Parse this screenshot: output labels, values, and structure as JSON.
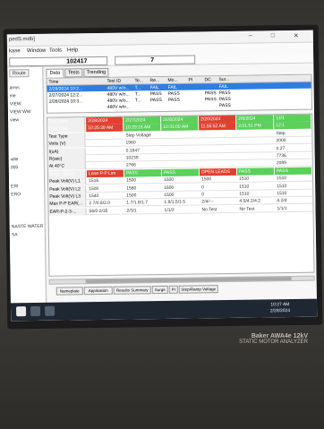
{
  "window": {
    "title": "pedS.mdb]",
    "controls": [
      "–",
      "□",
      "✕"
    ]
  },
  "menu": [
    "kase",
    "Window",
    "Tools",
    "Help"
  ],
  "id_fields": {
    "record_id": "102417",
    "count": "7"
  },
  "left_panel": {
    "tab": "Route",
    "items": [
      "arms",
      "me",
      "VIEW",
      "VIEW WW",
      "view",
      "",
      "ville",
      "005",
      "",
      "ERI",
      "ERO",
      "",
      "NASTE WATER",
      "SA"
    ]
  },
  "tabs": [
    "Data",
    "Tests",
    "Trending"
  ],
  "test_table": {
    "headers": [
      "Time",
      "Test ID",
      "Te...",
      "Re...",
      "Mo...",
      "PI",
      "DC",
      "Sur..."
    ],
    "rows": [
      {
        "time": "2/28/2024 10:2...",
        "test_id": "480V w/o...",
        "te": "T...",
        "re": "FAIL",
        "mo": "FAIL",
        "pi": "",
        "dc": "",
        "sur": "FAIL",
        "selected": true
      },
      {
        "time": "2/27/2024 12:2...",
        "test_id": "480V w/o...",
        "te": "T...",
        "re": "PASS",
        "mo": "PASS",
        "pi": "",
        "dc": "PASS",
        "sur": "PASS",
        "selected": false
      },
      {
        "time": "2/26/2024 10:3...",
        "test_id": "480V w/o...",
        "te": "T...",
        "re": "PASS",
        "mo": "PASS",
        "pi": "",
        "dc": "PASS",
        "sur": "PASS",
        "selected": false
      },
      {
        "time": "",
        "test_id": "480V w/o...",
        "te": "",
        "re": "",
        "mo": "",
        "pi": "",
        "dc": "",
        "sur": "PASS",
        "selected": false
      }
    ]
  },
  "data_grid": {
    "rows": [
      {
        "label": "Test Date",
        "label_style": "sel",
        "cells": [
          {
            "v": "2/28/2024",
            "s": "red"
          },
          {
            "v": "2/27/2024",
            "s": "green"
          },
          {
            "v": "2/26/2024",
            "s": "green"
          },
          {
            "v": "2/20/2024",
            "s": "red"
          },
          {
            "v": "2/8/2024",
            "s": "green"
          },
          {
            "v": "12/1",
            "s": "green"
          }
        ]
      },
      {
        "label": "Test Time",
        "label_style": "sel",
        "cells": [
          {
            "v": "10:25:39 AM",
            "s": "red"
          },
          {
            "v": "10:29:18 AM",
            "s": "green"
          },
          {
            "v": "10:31:00 AM",
            "s": "green"
          },
          {
            "v": "11:55:52 AM",
            "s": "red"
          },
          {
            "v": "2:01:51 PM",
            "s": "green"
          },
          {
            "v": "12:1",
            "s": "green"
          }
        ]
      },
      {
        "label": "Test Type",
        "cells": [
          {
            "v": "",
            "s": ""
          },
          {
            "v": "Step Voltage",
            "s": ""
          },
          {
            "v": "",
            "s": ""
          },
          {
            "v": "",
            "s": ""
          },
          {
            "v": "",
            "s": ""
          },
          {
            "v": "Step",
            "s": ""
          }
        ]
      },
      {
        "label": "Volts (V)",
        "cells": [
          {
            "v": "",
            "s": ""
          },
          {
            "v": "1960",
            "s": ""
          },
          {
            "v": "",
            "s": ""
          },
          {
            "v": "",
            "s": ""
          },
          {
            "v": "",
            "s": ""
          },
          {
            "v": "2000",
            "s": ""
          }
        ]
      },
      {
        "label": "I(uA)",
        "cells": [
          {
            "v": "",
            "s": ""
          },
          {
            "v": "0.1847",
            "s": ""
          },
          {
            "v": "",
            "s": ""
          },
          {
            "v": "",
            "s": ""
          },
          {
            "v": "",
            "s": ""
          },
          {
            "v": "0.27",
            "s": ""
          }
        ]
      },
      {
        "label": "R(sec)",
        "cells": [
          {
            "v": "",
            "s": ""
          },
          {
            "v": "10239",
            "s": ""
          },
          {
            "v": "",
            "s": ""
          },
          {
            "v": "",
            "s": ""
          },
          {
            "v": "",
            "s": ""
          },
          {
            "v": "7736",
            "s": ""
          }
        ]
      },
      {
        "label": "At 40°C",
        "cells": [
          {
            "v": "",
            "s": ""
          },
          {
            "v": "2766",
            "s": ""
          },
          {
            "v": "",
            "s": ""
          },
          {
            "v": "",
            "s": ""
          },
          {
            "v": "",
            "s": ""
          },
          {
            "v": "2089",
            "s": ""
          }
        ]
      },
      {
        "label": "Surge Status",
        "label_style": "sel",
        "cells": [
          {
            "v": "Lone P-P Lim",
            "s": "red"
          },
          {
            "v": "PASS",
            "s": "green"
          },
          {
            "v": "PASS",
            "s": "green"
          },
          {
            "v": "OPEN LEADS",
            "s": "red"
          },
          {
            "v": "PASS",
            "s": "green"
          },
          {
            "v": "PASS",
            "s": "green"
          }
        ]
      },
      {
        "label": "Peak Volt(V) L1",
        "cells": [
          {
            "v": "1516",
            "s": ""
          },
          {
            "v": "1500",
            "s": ""
          },
          {
            "v": "1500",
            "s": ""
          },
          {
            "v": "1500",
            "s": ""
          },
          {
            "v": "1510",
            "s": ""
          },
          {
            "v": "1510",
            "s": ""
          }
        ]
      },
      {
        "label": "Peak Volt(V) L2",
        "cells": [
          {
            "v": "1500",
            "s": ""
          },
          {
            "v": "1560",
            "s": ""
          },
          {
            "v": "1600",
            "s": ""
          },
          {
            "v": "0",
            "s": ""
          },
          {
            "v": "1510",
            "s": ""
          },
          {
            "v": "1510",
            "s": ""
          }
        ]
      },
      {
        "label": "Peak Volt(V) L3",
        "cells": [
          {
            "v": "1540",
            "s": ""
          },
          {
            "v": "1500",
            "s": ""
          },
          {
            "v": "1500",
            "s": ""
          },
          {
            "v": "0",
            "s": ""
          },
          {
            "v": "1510",
            "s": ""
          },
          {
            "v": "1510",
            "s": ""
          }
        ]
      },
      {
        "label": "Max P-P EAR(...",
        "cells": [
          {
            "v": "2.7/0.8/2.0",
            "s": ""
          },
          {
            "v": "1.7/1.8/1.7",
            "s": ""
          },
          {
            "v": "1.8/1.5/1.5",
            "s": ""
          },
          {
            "v": "2/4/---",
            "s": ""
          },
          {
            "v": "4.5/4.2/4.2",
            "s": ""
          },
          {
            "v": "4.2/4",
            "s": ""
          }
        ]
      },
      {
        "label": "EAR-P-2-3-...",
        "cells": [
          {
            "v": "56/0.0/35",
            "s": ""
          },
          {
            "v": "2/3/1",
            "s": ""
          },
          {
            "v": "1/1/2",
            "s": ""
          },
          {
            "v": "No Test",
            "s": ""
          },
          {
            "v": "No Test",
            "s": ""
          },
          {
            "v": "1/1/1",
            "s": ""
          }
        ]
      }
    ]
  },
  "bottom_tabs": [
    "Nameplate",
    "Application",
    "Results Summary",
    "Surge",
    "PI",
    "Step/Ramp Voltage"
  ],
  "taskbar": {
    "time": "10:27 AM",
    "date": "2/28/2024"
  },
  "bezel_text": {
    "brand": "Baker AWA4e 12kV",
    "sub": "STATIC MOTOR ANALYZER"
  },
  "colors": {
    "fail": "#e04030",
    "pass": "#5bd05b",
    "selected": "#2f7de1",
    "taskbar": "#1f2733"
  }
}
